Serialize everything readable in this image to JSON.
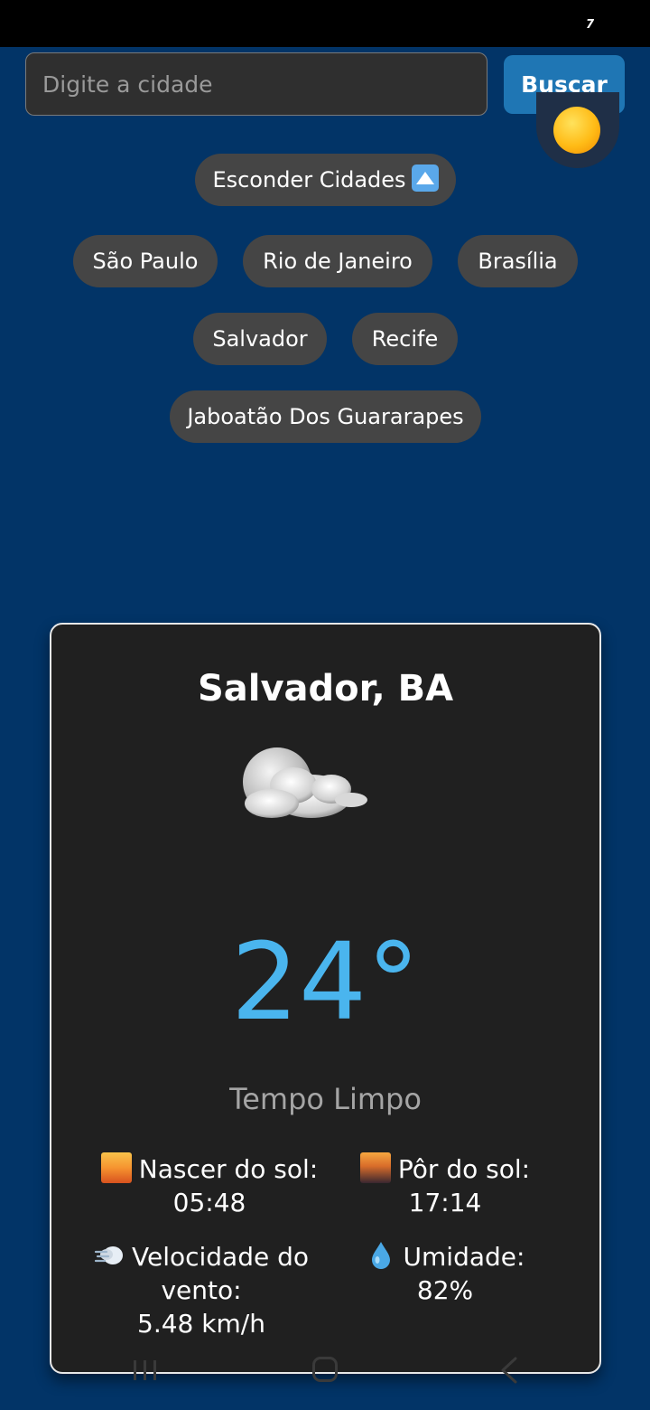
{
  "status_bar": {
    "indicator": "7"
  },
  "search": {
    "placeholder": "Digite a cidade",
    "value": "",
    "button_label": "Buscar"
  },
  "theme_toggle": {
    "icon": "sun-icon"
  },
  "city_list": {
    "toggle_label": "Esconder Cidades",
    "toggle_icon": "up-arrow-icon",
    "cities": [
      "São Paulo",
      "Rio de Janeiro",
      "Brasília",
      "Salvador",
      "Recife",
      "Jaboatão Dos Guararapes"
    ]
  },
  "weather": {
    "city": "Salvador, BA",
    "icon": "partly-cloudy-night-icon",
    "temperature": "24°",
    "description": "Tempo Limpo",
    "sunrise": {
      "label": "Nascer do sol:",
      "value": "05:48",
      "icon": "sunrise-icon"
    },
    "sunset": {
      "label": "Pôr do sol:",
      "value": "17:14",
      "icon": "sunset-city-icon"
    },
    "wind": {
      "label": "Velocidade do vento:",
      "value": "5.48 km/h",
      "icon": "wind-icon"
    },
    "humidity": {
      "label": "Umidade:",
      "value": "82%",
      "icon": "droplet-icon"
    }
  },
  "colors": {
    "background": "#023467",
    "card": "#202020",
    "accent": "#4ab5ee",
    "button": "#1f76b4",
    "pill": "#454545"
  }
}
